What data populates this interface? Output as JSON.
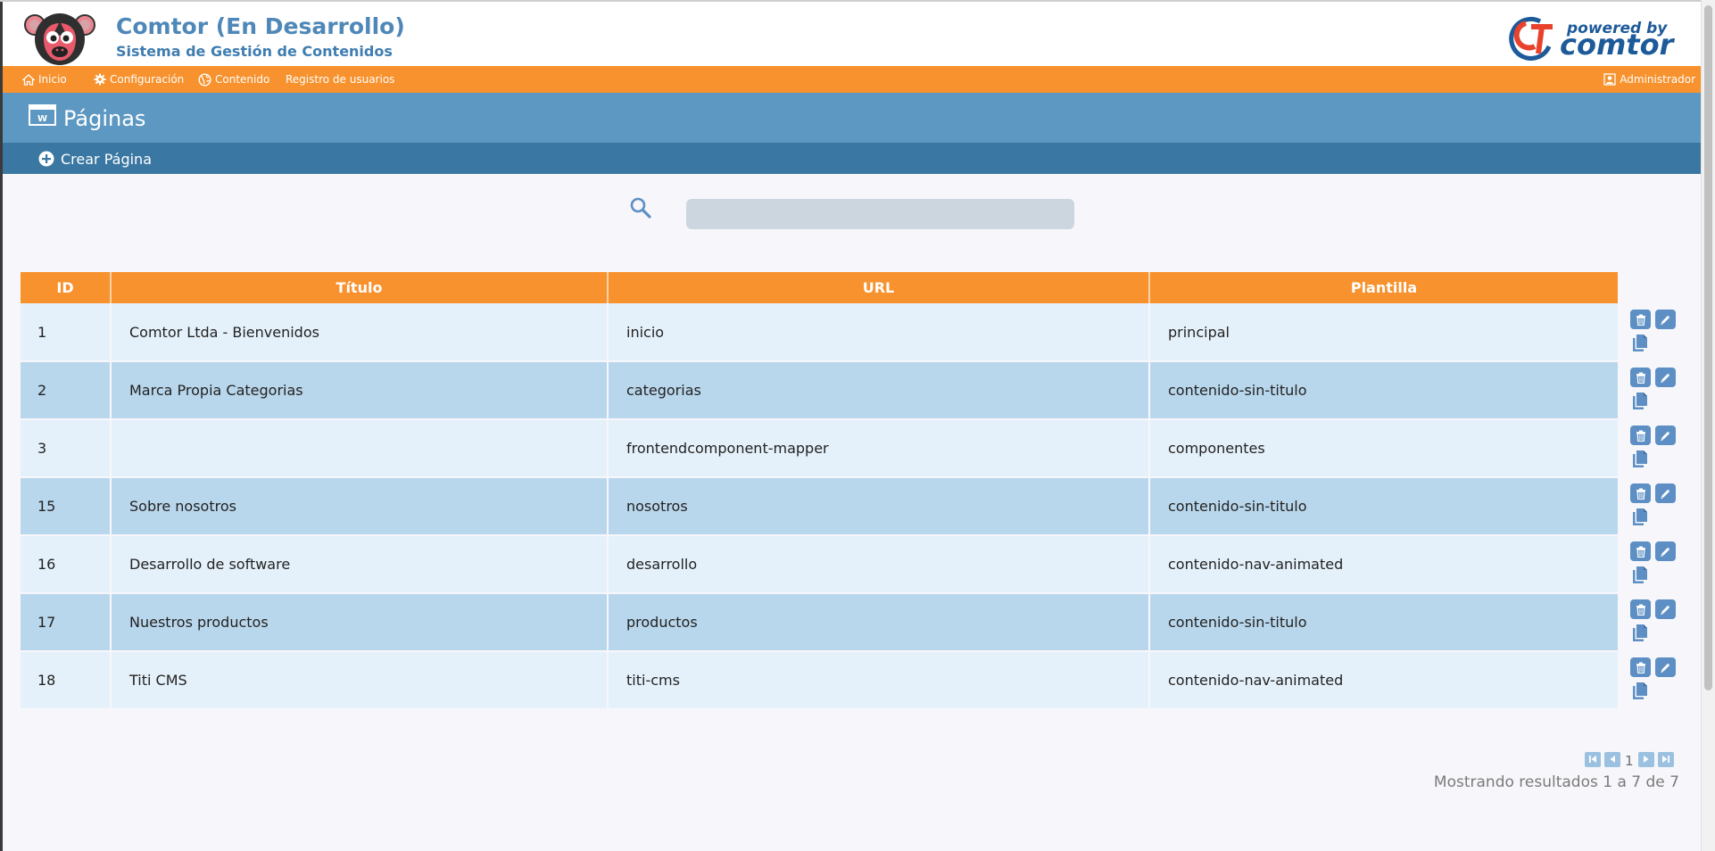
{
  "header": {
    "title": "Comtor (En Desarrollo)",
    "subtitle": "Sistema de Gestión de Contenidos",
    "brand_powered": "powered by",
    "brand_name": "comtor"
  },
  "nav": {
    "items": [
      {
        "label": "Inicio",
        "icon": "home-icon"
      },
      {
        "label": "Configuración",
        "icon": "gear-icon"
      },
      {
        "label": "Contenido",
        "icon": "globe-icon"
      },
      {
        "label": "Registro de usuarios",
        "icon": ""
      }
    ],
    "user_label": "Administrador"
  },
  "page": {
    "title": "Páginas",
    "icon_letter": "W",
    "create_label": "Crear Página"
  },
  "search": {
    "value": "",
    "placeholder": ""
  },
  "table": {
    "columns": [
      "ID",
      "Título",
      "URL",
      "Plantilla"
    ],
    "rows": [
      {
        "id": "1",
        "titulo": "Comtor Ltda - Bienvenidos",
        "url": "inicio",
        "plantilla": "principal"
      },
      {
        "id": "2",
        "titulo": "Marca Propia Categorias",
        "url": "categorias",
        "plantilla": "contenido-sin-titulo"
      },
      {
        "id": "3",
        "titulo": "",
        "url": "frontendcomponent-mapper",
        "plantilla": "componentes"
      },
      {
        "id": "15",
        "titulo": "Sobre nosotros",
        "url": "nosotros",
        "plantilla": "contenido-sin-titulo"
      },
      {
        "id": "16",
        "titulo": "Desarrollo de software",
        "url": "desarrollo",
        "plantilla": "contenido-nav-animated"
      },
      {
        "id": "17",
        "titulo": "Nuestros productos",
        "url": "productos",
        "plantilla": "contenido-sin-titulo"
      },
      {
        "id": "18",
        "titulo": "Titi CMS",
        "url": "titi-cms",
        "plantilla": "contenido-nav-animated"
      }
    ],
    "row_actions": [
      "trash-icon",
      "pencil-icon",
      "copy-icon"
    ]
  },
  "pagination": {
    "current_page": "1",
    "results_text": "Mostrando resultados 1 a 7 de 7"
  },
  "colors": {
    "nav_orange": "#f7922e",
    "page_header_blue": "#5d98c2",
    "action_bar_blue": "#3a77a2",
    "title_blue": "#4f88b8",
    "row_light": "#e5f1fa",
    "row_dark": "#b9d7ec",
    "action_button": "#5d8fc4"
  }
}
